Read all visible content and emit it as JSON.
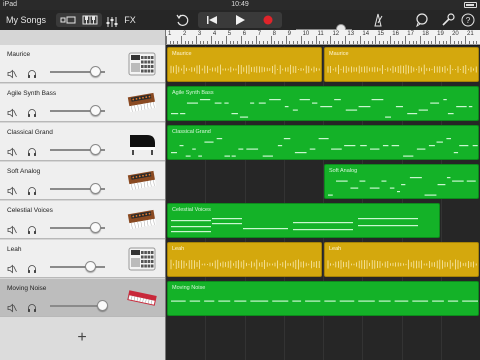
{
  "status_bar": {
    "device": "iPad",
    "time": "10:49"
  },
  "toolbar": {
    "my_songs_label": "My Songs",
    "fx_label": "FX",
    "icons": [
      "browser-view-icon",
      "keyboard-icon",
      "mixer-icon",
      "undo-icon",
      "rewind-icon",
      "play-icon",
      "record-icon",
      "metronome-icon",
      "loop-browser-icon",
      "settings-icon",
      "help-icon"
    ],
    "record_color": "#e0242a",
    "master_volume_level": 0.8
  },
  "ruler": {
    "bars": [
      "1",
      "2",
      "3",
      "4",
      "5",
      "6",
      "7",
      "8",
      "9",
      "10",
      "11",
      "12",
      "13",
      "14",
      "15",
      "16",
      "17",
      "18",
      "19",
      "20",
      "21"
    ]
  },
  "tracks": [
    {
      "name": "Maurice",
      "instrument": "drum-machine-icon",
      "volume": 0.82,
      "selected": false
    },
    {
      "name": "Agile Synth Bass",
      "instrument": "synth-keyboard-icon",
      "volume": 0.82,
      "selected": false
    },
    {
      "name": "Classical Grand",
      "instrument": "grand-piano-icon",
      "volume": 0.82,
      "selected": false
    },
    {
      "name": "Soft Analog",
      "instrument": "synth-keyboard-icon",
      "volume": 0.82,
      "selected": false
    },
    {
      "name": "Celestial Voices",
      "instrument": "synth-keyboard-icon",
      "volume": 0.82,
      "selected": false
    },
    {
      "name": "Leah",
      "instrument": "drum-machine-icon",
      "volume": 0.73,
      "selected": false
    },
    {
      "name": "Moving Noise",
      "instrument": "red-keyboard-icon",
      "volume": 0.95,
      "selected": true
    }
  ],
  "regions": [
    {
      "lane": 0,
      "label": "Maurice",
      "kind": "drums",
      "color": "yellow",
      "start": 0,
      "end": 0.5
    },
    {
      "lane": 0,
      "label": "Maurice",
      "kind": "drums",
      "color": "yellow",
      "start": 0.5,
      "end": 1.0
    },
    {
      "lane": 1,
      "label": "Agile Synth Bass",
      "kind": "midi",
      "color": "green",
      "start": 0,
      "end": 1.0
    },
    {
      "lane": 2,
      "label": "Classical Grand",
      "kind": "midi",
      "color": "green",
      "start": 0,
      "end": 1.0
    },
    {
      "lane": 3,
      "label": "Soft Analog",
      "kind": "midi",
      "color": "green",
      "start": 0.5,
      "end": 1.0
    },
    {
      "lane": 4,
      "label": "Celestial Voices",
      "kind": "sustain",
      "color": "green",
      "start": 0,
      "end": 0.875
    },
    {
      "lane": 5,
      "label": "Leah",
      "kind": "drums",
      "color": "yellow",
      "start": 0,
      "end": 0.5
    },
    {
      "lane": 5,
      "label": "Leah",
      "kind": "drums",
      "color": "yellow",
      "start": 0.5,
      "end": 1.0
    },
    {
      "lane": 6,
      "label": "Moving Noise",
      "kind": "line",
      "color": "green",
      "start": 0,
      "end": 1.0
    }
  ],
  "add_track_label": "+"
}
